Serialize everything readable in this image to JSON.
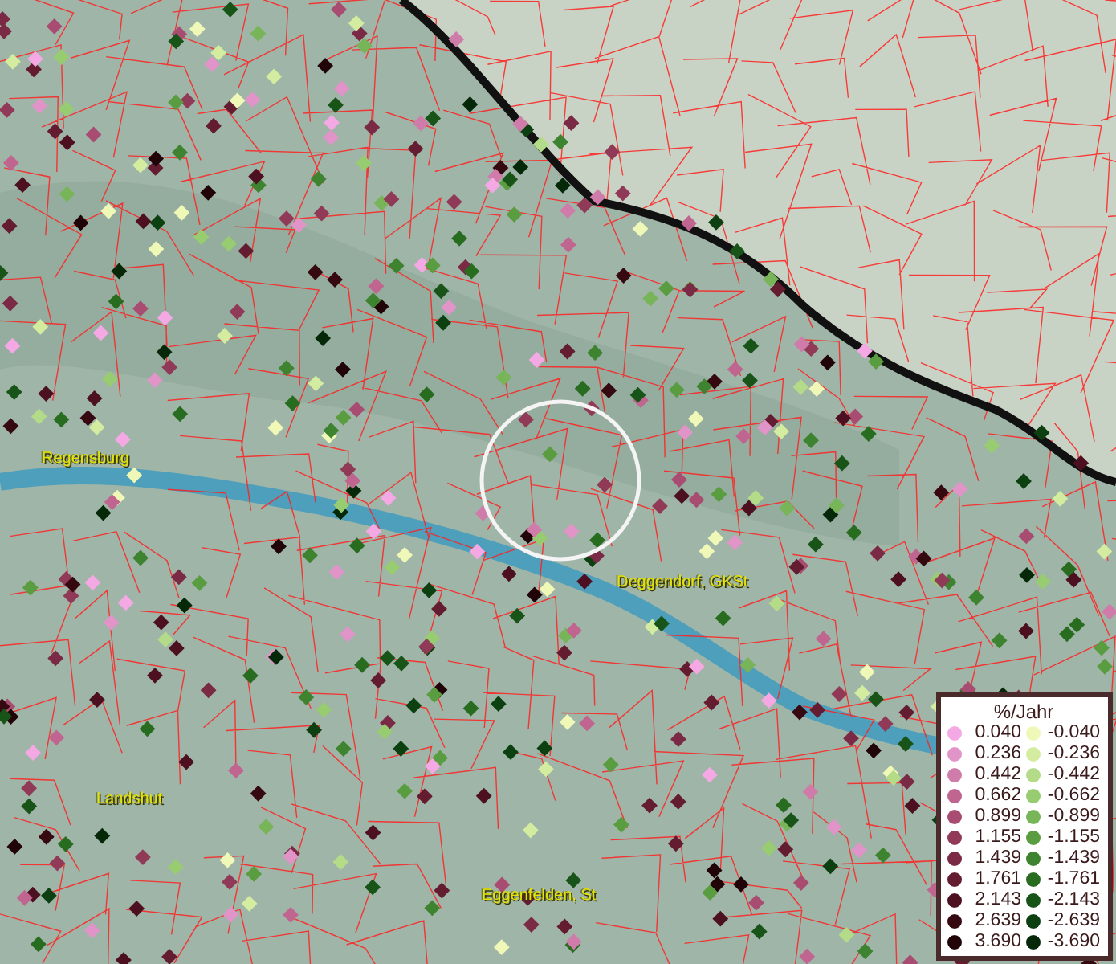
{
  "map": {
    "places": [
      {
        "name": "Regensburg"
      },
      {
        "name": "Deggendorf, GKSt"
      },
      {
        "name": "Landshut"
      },
      {
        "name": "Eggenfelden, St"
      }
    ]
  },
  "legend": {
    "title": "%/Jahr",
    "rows": [
      {
        "left": {
          "label": "0.040",
          "color": "#f4a8e4"
        },
        "right": {
          "label": "-0.040",
          "color": "#f0f8b8"
        }
      },
      {
        "left": {
          "label": "0.236",
          "color": "#e094c8"
        },
        "right": {
          "label": "-0.236",
          "color": "#d4eca0"
        }
      },
      {
        "left": {
          "label": "0.442",
          "color": "#d07caa"
        },
        "right": {
          "label": "-0.442",
          "color": "#b4dc88"
        }
      },
      {
        "left": {
          "label": "0.662",
          "color": "#c06490"
        },
        "right": {
          "label": "-0.662",
          "color": "#98cc70"
        }
      },
      {
        "left": {
          "label": "0.899",
          "color": "#a84c72"
        },
        "right": {
          "label": "-0.899",
          "color": "#78b458"
        }
      },
      {
        "left": {
          "label": "1.155",
          "color": "#903a58"
        },
        "right": {
          "label": "-1.155",
          "color": "#5a9c40"
        }
      },
      {
        "left": {
          "label": "1.439",
          "color": "#7a2a44"
        },
        "right": {
          "label": "-1.439",
          "color": "#3e8430"
        }
      },
      {
        "left": {
          "label": "1.761",
          "color": "#641c30"
        },
        "right": {
          "label": "-1.761",
          "color": "#286c20"
        }
      },
      {
        "left": {
          "label": "2.143",
          "color": "#4c1020"
        },
        "right": {
          "label": "-2.143",
          "color": "#185418"
        }
      },
      {
        "left": {
          "label": "2.639",
          "color": "#360810"
        },
        "right": {
          "label": "-2.639",
          "color": "#0c4010"
        }
      },
      {
        "left": {
          "label": "3.690",
          "color": "#200408"
        },
        "right": {
          "label": "-3.690",
          "color": "#042808"
        }
      }
    ]
  }
}
